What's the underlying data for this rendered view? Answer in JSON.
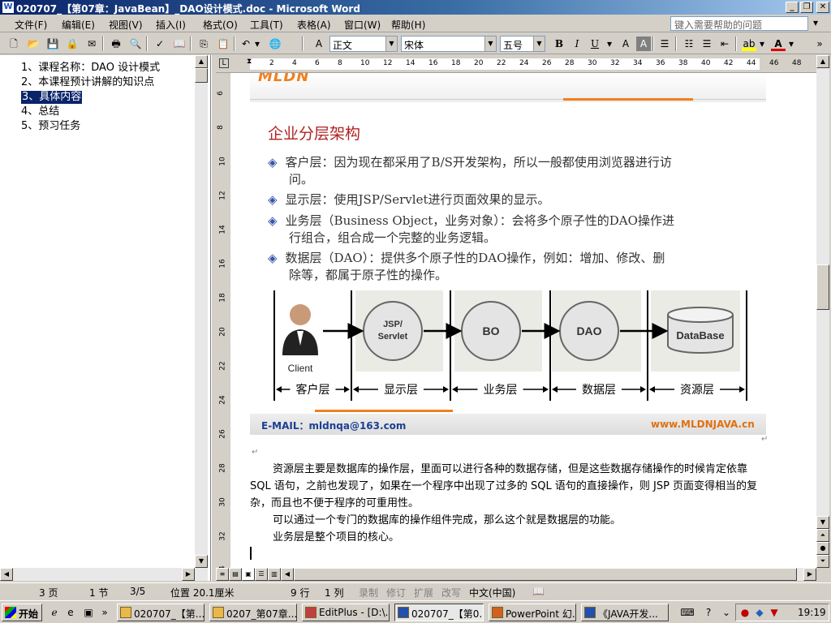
{
  "window": {
    "title": "020707_【第07章：JavaBean】_DAO设计模式.doc - Microsoft Word",
    "buttons": [
      "_",
      "❐",
      "✕"
    ]
  },
  "menubar": {
    "items": [
      "文件(F)",
      "编辑(E)",
      "视图(V)",
      "插入(I)",
      "格式(O)",
      "工具(T)",
      "表格(A)",
      "窗口(W)",
      "帮助(H)"
    ],
    "help_placeholder": "键入需要帮助的问题"
  },
  "toolbar": {
    "style": "正文",
    "font": "宋体",
    "size": "五号",
    "bold": "B",
    "italic": "I",
    "underline": "U"
  },
  "docmap": {
    "items": [
      "1、课程名称：DAO 设计模式",
      "2、本课程预计讲解的知识点",
      "3、具体内容",
      "4、总结",
      "5、预习任务"
    ],
    "selected_index": 2
  },
  "ruler": {
    "h_ticks": [
      "2",
      "4",
      "6",
      "8",
      "10",
      "12",
      "14",
      "16",
      "18",
      "20",
      "22",
      "24",
      "26",
      "28",
      "30",
      "32",
      "34",
      "36",
      "38",
      "40",
      "42",
      "44",
      "46",
      "48"
    ],
    "v_ticks": [
      "6",
      "8",
      "10",
      "12",
      "14",
      "16",
      "18",
      "20",
      "22",
      "24",
      "26",
      "28",
      "30",
      "32",
      "34"
    ]
  },
  "slide": {
    "logo": "MLDN",
    "title": "企业分层架构",
    "bullets": [
      {
        "line1": "客户层：因为现在都采用了B/S开发架构，所以一般都使用浏览器进行访",
        "line2": "问。"
      },
      {
        "line1": "显示层：使用JSP/Servlet进行页面效果的显示。",
        "line2": ""
      },
      {
        "line1": "业务层（Business Object，业务对象）：会将多个原子性的DAO操作进",
        "line2": "行组合，组合成一个完整的业务逻辑。"
      },
      {
        "line1": "数据层（DAO）：提供多个原子性的DAO操作，例如：增加、修改、删",
        "line2": "除等，都属于原子性的操作。"
      }
    ],
    "footer_email": "E-MAIL：mldnqa@163.com",
    "footer_site": "www.MLDNJAVA.cn"
  },
  "chart_data": {
    "type": "diagram",
    "nodes": [
      {
        "id": "client",
        "label": "Client",
        "layer": "客户层"
      },
      {
        "id": "jsp",
        "label": "JSP/ Servlet",
        "layer": "显示层"
      },
      {
        "id": "bo",
        "label": "BO",
        "layer": "业务层"
      },
      {
        "id": "dao",
        "label": "DAO",
        "layer": "数据层"
      },
      {
        "id": "db",
        "label": "DataBase",
        "layer": "资源层"
      }
    ],
    "edges": [
      [
        "client",
        "jsp"
      ],
      [
        "jsp",
        "bo"
      ],
      [
        "bo",
        "dao"
      ],
      [
        "dao",
        "db"
      ]
    ],
    "layers": [
      "客户层",
      "显示层",
      "业务层",
      "数据层",
      "资源层"
    ]
  },
  "document": {
    "paragraphs": [
      "资源层主要是数据库的操作层，里面可以进行各种的数据存储，但是这些数据存储操作的时候肯定依靠 SQL 语句，之前也发现了，如果在一个程序中出现了过多的 SQL 语句的直接操作，则 JSP 页面变得相当的复杂，而且也不便于程序的可重用性。",
      "可以通过一个专门的数据库的操作组件完成，那么这个就是数据层的功能。",
      "业务层是整个项目的核心。"
    ]
  },
  "statusbar": {
    "page": "3 页",
    "section": "1 节",
    "pages": "3/5",
    "position": "位置 20.1厘米",
    "line": "9 行",
    "col": "1 列",
    "rec": "录制",
    "trk": "修订",
    "ext": "扩展",
    "ovr": "改写",
    "lang": "中文(中国)"
  },
  "taskbar": {
    "start": "开始",
    "tasks": [
      "020707_【第...",
      "0207_第07章...",
      "EditPlus - [D:\\...",
      "020707_【第0...",
      "PowerPoint 幻...",
      "《JAVA开发..."
    ],
    "active_index": 3,
    "clock": "19:19"
  }
}
